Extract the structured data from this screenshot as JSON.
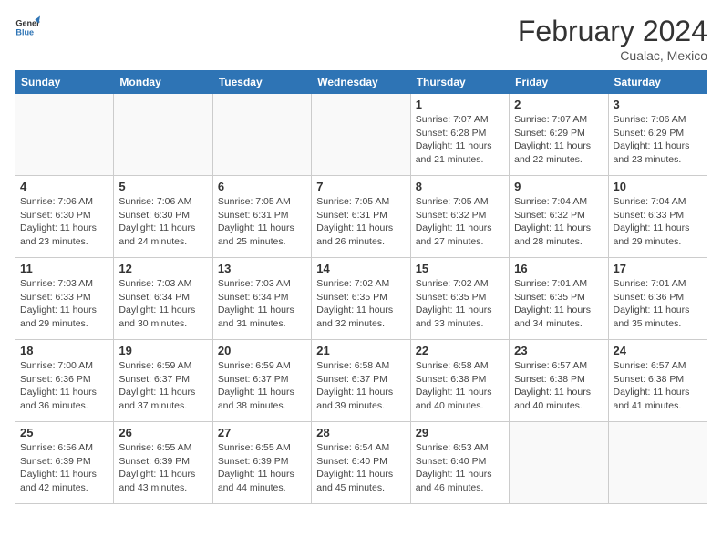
{
  "logo": {
    "text_general": "General",
    "text_blue": "Blue"
  },
  "header": {
    "month": "February 2024",
    "location": "Cualac, Mexico"
  },
  "weekdays": [
    "Sunday",
    "Monday",
    "Tuesday",
    "Wednesday",
    "Thursday",
    "Friday",
    "Saturday"
  ],
  "weeks": [
    [
      {
        "day": "",
        "info": ""
      },
      {
        "day": "",
        "info": ""
      },
      {
        "day": "",
        "info": ""
      },
      {
        "day": "",
        "info": ""
      },
      {
        "day": "1",
        "info": "Sunrise: 7:07 AM\nSunset: 6:28 PM\nDaylight: 11 hours\nand 21 minutes."
      },
      {
        "day": "2",
        "info": "Sunrise: 7:07 AM\nSunset: 6:29 PM\nDaylight: 11 hours\nand 22 minutes."
      },
      {
        "day": "3",
        "info": "Sunrise: 7:06 AM\nSunset: 6:29 PM\nDaylight: 11 hours\nand 23 minutes."
      }
    ],
    [
      {
        "day": "4",
        "info": "Sunrise: 7:06 AM\nSunset: 6:30 PM\nDaylight: 11 hours\nand 23 minutes."
      },
      {
        "day": "5",
        "info": "Sunrise: 7:06 AM\nSunset: 6:30 PM\nDaylight: 11 hours\nand 24 minutes."
      },
      {
        "day": "6",
        "info": "Sunrise: 7:05 AM\nSunset: 6:31 PM\nDaylight: 11 hours\nand 25 minutes."
      },
      {
        "day": "7",
        "info": "Sunrise: 7:05 AM\nSunset: 6:31 PM\nDaylight: 11 hours\nand 26 minutes."
      },
      {
        "day": "8",
        "info": "Sunrise: 7:05 AM\nSunset: 6:32 PM\nDaylight: 11 hours\nand 27 minutes."
      },
      {
        "day": "9",
        "info": "Sunrise: 7:04 AM\nSunset: 6:32 PM\nDaylight: 11 hours\nand 28 minutes."
      },
      {
        "day": "10",
        "info": "Sunrise: 7:04 AM\nSunset: 6:33 PM\nDaylight: 11 hours\nand 29 minutes."
      }
    ],
    [
      {
        "day": "11",
        "info": "Sunrise: 7:03 AM\nSunset: 6:33 PM\nDaylight: 11 hours\nand 29 minutes."
      },
      {
        "day": "12",
        "info": "Sunrise: 7:03 AM\nSunset: 6:34 PM\nDaylight: 11 hours\nand 30 minutes."
      },
      {
        "day": "13",
        "info": "Sunrise: 7:03 AM\nSunset: 6:34 PM\nDaylight: 11 hours\nand 31 minutes."
      },
      {
        "day": "14",
        "info": "Sunrise: 7:02 AM\nSunset: 6:35 PM\nDaylight: 11 hours\nand 32 minutes."
      },
      {
        "day": "15",
        "info": "Sunrise: 7:02 AM\nSunset: 6:35 PM\nDaylight: 11 hours\nand 33 minutes."
      },
      {
        "day": "16",
        "info": "Sunrise: 7:01 AM\nSunset: 6:35 PM\nDaylight: 11 hours\nand 34 minutes."
      },
      {
        "day": "17",
        "info": "Sunrise: 7:01 AM\nSunset: 6:36 PM\nDaylight: 11 hours\nand 35 minutes."
      }
    ],
    [
      {
        "day": "18",
        "info": "Sunrise: 7:00 AM\nSunset: 6:36 PM\nDaylight: 11 hours\nand 36 minutes."
      },
      {
        "day": "19",
        "info": "Sunrise: 6:59 AM\nSunset: 6:37 PM\nDaylight: 11 hours\nand 37 minutes."
      },
      {
        "day": "20",
        "info": "Sunrise: 6:59 AM\nSunset: 6:37 PM\nDaylight: 11 hours\nand 38 minutes."
      },
      {
        "day": "21",
        "info": "Sunrise: 6:58 AM\nSunset: 6:37 PM\nDaylight: 11 hours\nand 39 minutes."
      },
      {
        "day": "22",
        "info": "Sunrise: 6:58 AM\nSunset: 6:38 PM\nDaylight: 11 hours\nand 40 minutes."
      },
      {
        "day": "23",
        "info": "Sunrise: 6:57 AM\nSunset: 6:38 PM\nDaylight: 11 hours\nand 40 minutes."
      },
      {
        "day": "24",
        "info": "Sunrise: 6:57 AM\nSunset: 6:38 PM\nDaylight: 11 hours\nand 41 minutes."
      }
    ],
    [
      {
        "day": "25",
        "info": "Sunrise: 6:56 AM\nSunset: 6:39 PM\nDaylight: 11 hours\nand 42 minutes."
      },
      {
        "day": "26",
        "info": "Sunrise: 6:55 AM\nSunset: 6:39 PM\nDaylight: 11 hours\nand 43 minutes."
      },
      {
        "day": "27",
        "info": "Sunrise: 6:55 AM\nSunset: 6:39 PM\nDaylight: 11 hours\nand 44 minutes."
      },
      {
        "day": "28",
        "info": "Sunrise: 6:54 AM\nSunset: 6:40 PM\nDaylight: 11 hours\nand 45 minutes."
      },
      {
        "day": "29",
        "info": "Sunrise: 6:53 AM\nSunset: 6:40 PM\nDaylight: 11 hours\nand 46 minutes."
      },
      {
        "day": "",
        "info": ""
      },
      {
        "day": "",
        "info": ""
      }
    ]
  ]
}
